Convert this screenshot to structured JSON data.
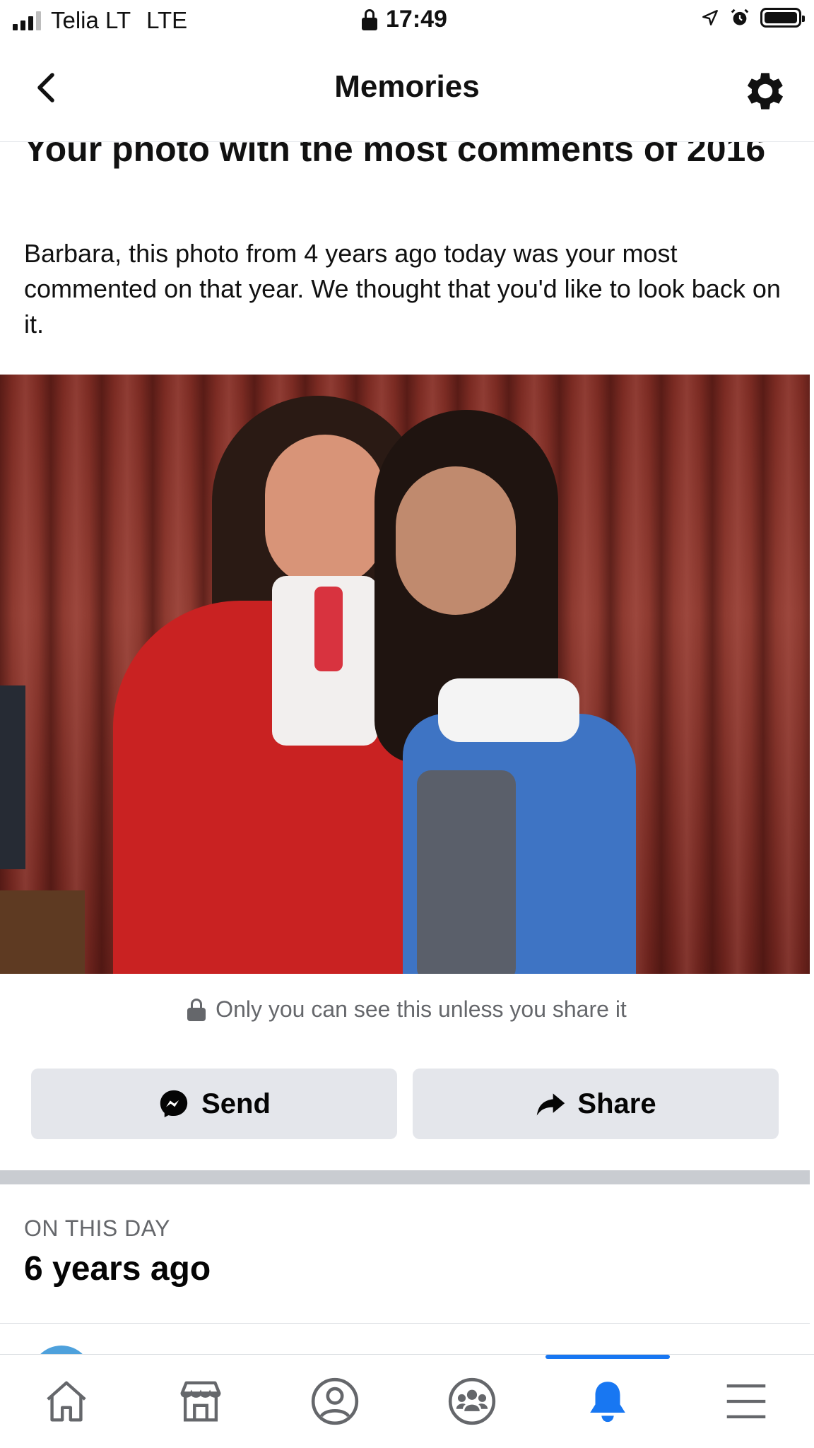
{
  "status_bar": {
    "carrier": "Telia LT",
    "network": "LTE",
    "time": "17:49"
  },
  "header": {
    "title": "Memories"
  },
  "memory": {
    "headline": "Your photo with the most comments of 2016",
    "description": "Barbara, this photo from 4 years ago today was your most commented on that year. We thought that you'd like to look back on it.",
    "privacy_note": "Only you can see this unless you share it",
    "send_label": "Send",
    "share_label": "Share"
  },
  "on_this_day": {
    "label": "ON THIS DAY",
    "title": "6 years ago"
  },
  "tabbar": {
    "items": [
      "home-icon",
      "marketplace-icon",
      "profile-icon",
      "groups-icon",
      "notifications-icon",
      "menu-icon"
    ],
    "active": "notifications-icon",
    "accent": "#1877f2"
  }
}
